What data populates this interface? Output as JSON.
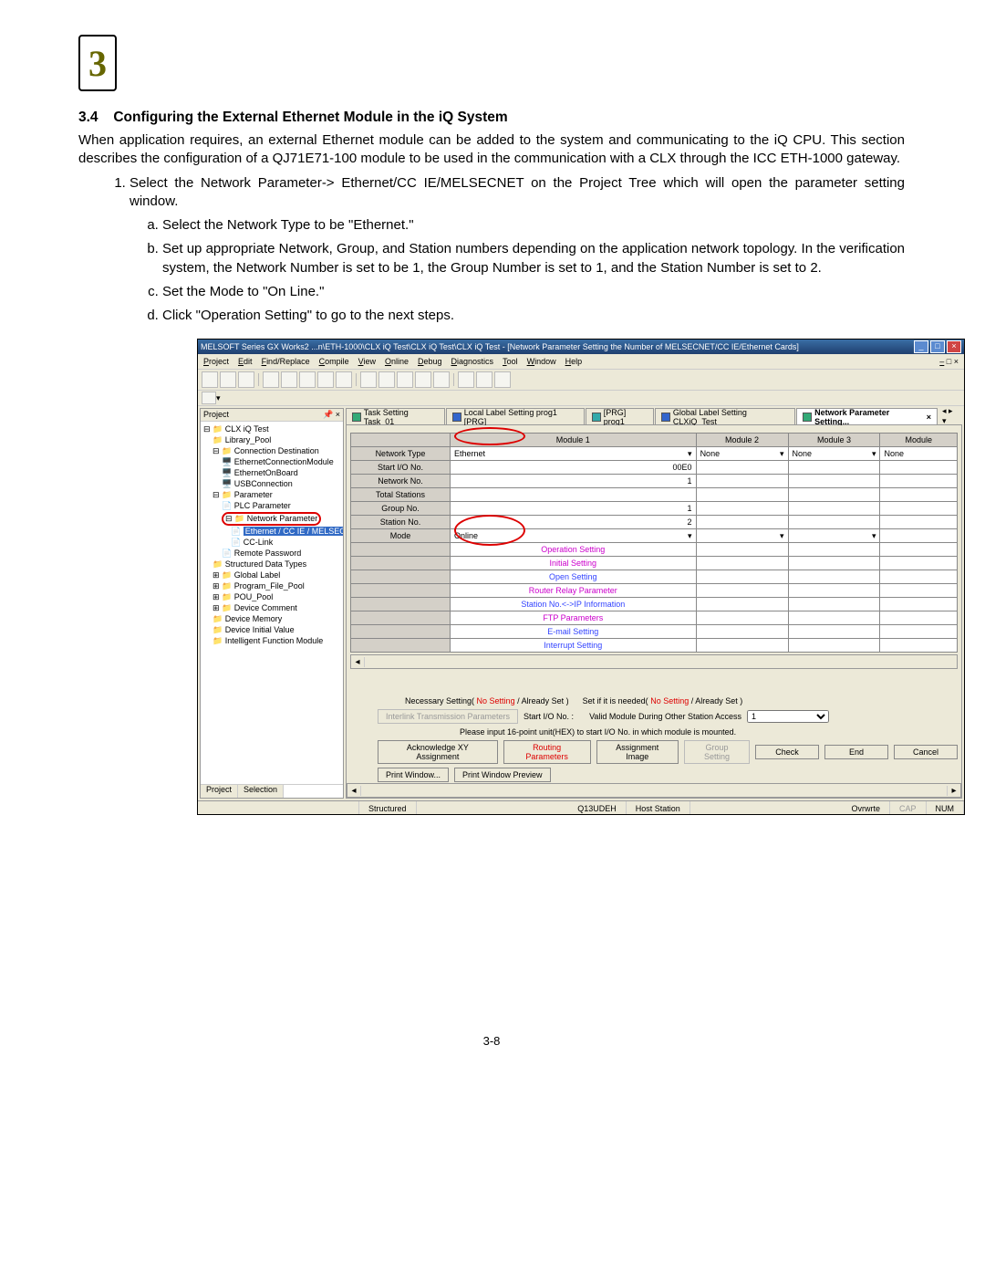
{
  "chapter_badge": "3",
  "section": {
    "number": "3.4",
    "title": "Configuring the External Ethernet Module in the iQ System"
  },
  "intro": "When application requires, an external Ethernet module can be added to the system and communicating to the iQ CPU. This section describes the configuration of a QJ71E71-100 module to be used in the communication with a CLX through the ICC ETH-1000 gateway.",
  "step1": "Select the Network Parameter-> Ethernet/CC IE/MELSECNET on the Project Tree which will open the parameter setting window.",
  "step1a": "Select the Network Type to be \"Ethernet.\"",
  "step1b": "Set up appropriate Network, Group, and Station numbers depending on the application network topology. In the verification system, the Network Number is set to be 1, the Group Number is set to 1, and the Station Number is set to 2.",
  "step1c": "Set the Mode to \"On Line.\"",
  "step1d": "Click \"Operation Setting\" to go to the next steps.",
  "app": {
    "title": "MELSOFT Series GX Works2 ...n\\ETH-1000\\CLX iQ Test\\CLX iQ Test\\CLX iQ Test - [Network Parameter Setting the Number of MELSECNET/CC IE/Ethernet Cards]",
    "menu": [
      "Project",
      "Edit",
      "Find/Replace",
      "Compile",
      "View",
      "Online",
      "Debug",
      "Diagnostics",
      "Tool",
      "Window",
      "Help"
    ],
    "project_pane_title": "Project",
    "tree": {
      "root": "CLX iQ Test",
      "items": [
        "Library_Pool",
        "Connection Destination",
        "EthernetConnectionModule",
        "EthernetOnBoard",
        "USBConnection",
        "Parameter",
        "PLC Parameter",
        "Network Parameter",
        "Ethernet / CC IE / MELSECNET",
        "CC-Link",
        "Remote Password",
        "Structured Data Types",
        "Global Label",
        "Program_File_Pool",
        "POU_Pool",
        "Device Comment",
        "Device Memory",
        "Device Initial Value",
        "Intelligent Function Module"
      ]
    },
    "pane_tabs": [
      "Project",
      "Selection"
    ],
    "tabs": [
      "Task Setting Task_01",
      "Local Label Setting prog1 [PRG]",
      "[PRG] prog1",
      "Global Label Setting CLXiQ_Test",
      "Network Parameter Setting..."
    ],
    "grid": {
      "col_headers": [
        "",
        "Module 1",
        "Module 2",
        "Module 3",
        "Module"
      ],
      "rows": [
        {
          "label": "Network Type",
          "v1": "Ethernet",
          "v2": "None",
          "v3": "None",
          "v4": "None"
        },
        {
          "label": "Start I/O No.",
          "v1": "00E0",
          "v2": "",
          "v3": "",
          "v4": ""
        },
        {
          "label": "Network No.",
          "v1": "1",
          "v2": "",
          "v3": "",
          "v4": ""
        },
        {
          "label": "Total Stations",
          "v1": "",
          "v2": "",
          "v3": "",
          "v4": ""
        },
        {
          "label": "Group No.",
          "v1": "1",
          "v2": "",
          "v3": "",
          "v4": ""
        },
        {
          "label": "Station No.",
          "v1": "2",
          "v2": "",
          "v3": "",
          "v4": ""
        },
        {
          "label": "Mode",
          "v1": "Online",
          "v2": "",
          "v3": "",
          "v4": ""
        }
      ],
      "link_rows": [
        "Operation Setting",
        "Initial Setting",
        "Open Setting",
        "Router Relay Parameter",
        "Station No.<->IP Information",
        "FTP Parameters",
        "E-mail Setting",
        "Interrupt Setting"
      ]
    },
    "legend": {
      "necessary": "Necessary Setting(",
      "no_setting": "No Setting",
      "already": " /  Already Set  )",
      "setif": "Set if it is needed(",
      "start_io_label": "Start I/O No. :",
      "valid_module_label": "Valid Module During Other Station Access",
      "valid_module_value": "1",
      "hint": "Please input 16-point unit(HEX) to start I/O No. in which module is mounted."
    },
    "buttons": {
      "interlink": "Interlink Transmission Parameters",
      "ack_xy": "Acknowledge XY Assignment",
      "routing": "Routing Parameters",
      "assignment": "Assignment Image",
      "group": "Group Setting",
      "check": "Check",
      "end": "End",
      "cancel": "Cancel",
      "print_window": "Print Window...",
      "print_preview": "Print Window Preview"
    },
    "status": {
      "left": "Structured",
      "center": "Q13UDEH",
      "center2": "Host Station",
      "right1": "Ovrwrte",
      "right2": "CAP",
      "right3": "NUM"
    }
  },
  "page_number": "3-8"
}
